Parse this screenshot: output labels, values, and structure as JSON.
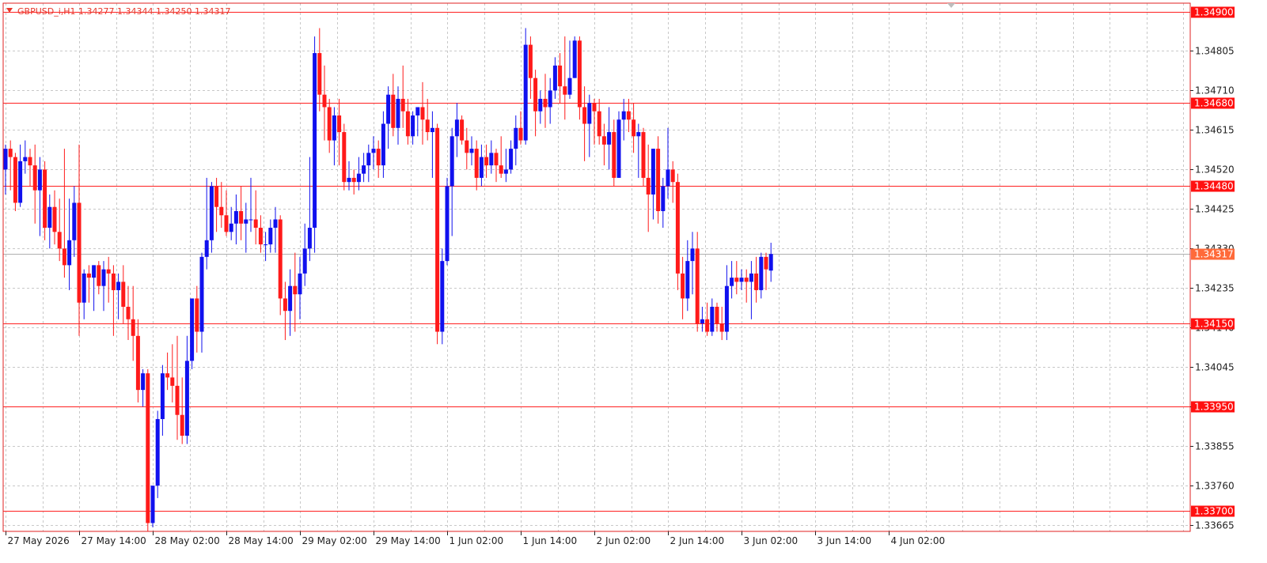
{
  "header": {
    "symbol_line": "GBPUSD_i,H1  1.34277 1.34344 1.34250 1.34317"
  },
  "colors": {
    "bull": "#1010ee",
    "bear": "#ff1a1a",
    "grid": "#c8c8c8",
    "frame": "#e02020",
    "level": "#ff2020",
    "level_label_bg": "#ff1010",
    "current_label_bg": "#ff6a3a",
    "text": "#222222"
  },
  "chart_data": {
    "type": "candlestick",
    "symbol": "GBPUSD_i",
    "timeframe": "H1",
    "last_bar": {
      "open": 1.34277,
      "high": 1.34344,
      "low": 1.3425,
      "close": 1.34317
    },
    "current_price": "1.34317",
    "y_range": [
      1.3365,
      1.3492
    ],
    "y_ticks": [
      "1.34805",
      "1.34710",
      "1.34615",
      "1.34520",
      "1.34425",
      "1.34330",
      "1.34235",
      "1.34140",
      "1.34045",
      "1.33950",
      "1.33855",
      "1.33760",
      "1.33665"
    ],
    "levels": [
      "1.34900",
      "1.34680",
      "1.34480",
      "1.34150",
      "1.33950",
      "1.33700"
    ],
    "x_labels": [
      "27 May 2026",
      "27 May 14:00",
      "28 May 02:00",
      "28 May 14:00",
      "29 May 02:00",
      "29 May 14:00",
      "1 Jun 02:00",
      "1 Jun 14:00",
      "2 Jun 02:00",
      "2 Jun 14:00",
      "3 Jun 02:00",
      "3 Jun 14:00",
      "4 Jun 02:00"
    ],
    "candles": [
      [
        1.3452,
        1.3458,
        1.3446,
        1.3457
      ],
      [
        1.3457,
        1.3459,
        1.3447,
        1.3455
      ],
      [
        1.3455,
        1.3456,
        1.3442,
        1.3444
      ],
      [
        1.3444,
        1.3458,
        1.3443,
        1.3454
      ],
      [
        1.3454,
        1.3459,
        1.3451,
        1.3455
      ],
      [
        1.3455,
        1.3457,
        1.3448,
        1.3453
      ],
      [
        1.3453,
        1.3458,
        1.3439,
        1.3447
      ],
      [
        1.3447,
        1.3455,
        1.3436,
        1.3452
      ],
      [
        1.3452,
        1.3454,
        1.3435,
        1.3438
      ],
      [
        1.3438,
        1.3446,
        1.3433,
        1.3443
      ],
      [
        1.3443,
        1.3447,
        1.3434,
        1.3437
      ],
      [
        1.3437,
        1.3445,
        1.343,
        1.3433
      ],
      [
        1.3433,
        1.3457,
        1.3426,
        1.3429
      ],
      [
        1.3429,
        1.3445,
        1.3423,
        1.3435
      ],
      [
        1.3435,
        1.3448,
        1.3431,
        1.3444
      ],
      [
        1.3444,
        1.3458,
        1.3412,
        1.342
      ],
      [
        1.342,
        1.3428,
        1.3416,
        1.3427
      ],
      [
        1.3427,
        1.3429,
        1.342,
        1.3426
      ],
      [
        1.3426,
        1.3429,
        1.3418,
        1.3429
      ],
      [
        1.3429,
        1.343,
        1.3422,
        1.3424
      ],
      [
        1.3424,
        1.343,
        1.3418,
        1.3428
      ],
      [
        1.3428,
        1.3431,
        1.342,
        1.3427
      ],
      [
        1.3427,
        1.3429,
        1.3412,
        1.3423
      ],
      [
        1.3423,
        1.3427,
        1.3416,
        1.3425
      ],
      [
        1.3425,
        1.3429,
        1.3415,
        1.3419
      ],
      [
        1.3419,
        1.3424,
        1.3411,
        1.3416
      ],
      [
        1.3416,
        1.3424,
        1.3406,
        1.3412
      ],
      [
        1.3412,
        1.3416,
        1.3396,
        1.3399
      ],
      [
        1.3399,
        1.3404,
        1.3395,
        1.3403
      ],
      [
        1.3403,
        1.3404,
        1.3365,
        1.3367
      ],
      [
        1.3367,
        1.3375,
        1.3366,
        1.3376
      ],
      [
        1.3376,
        1.3394,
        1.3373,
        1.3392
      ],
      [
        1.3392,
        1.3405,
        1.3388,
        1.3403
      ],
      [
        1.3403,
        1.3408,
        1.3399,
        1.3402
      ],
      [
        1.3402,
        1.341,
        1.3396,
        1.34
      ],
      [
        1.34,
        1.3412,
        1.3387,
        1.3393
      ],
      [
        1.3393,
        1.3402,
        1.3386,
        1.3388
      ],
      [
        1.3388,
        1.3412,
        1.3386,
        1.3406
      ],
      [
        1.3406,
        1.342,
        1.3404,
        1.3421
      ],
      [
        1.3421,
        1.3424,
        1.3408,
        1.3413
      ],
      [
        1.3413,
        1.3432,
        1.3408,
        1.3431
      ],
      [
        1.3431,
        1.345,
        1.3428,
        1.3435
      ],
      [
        1.3435,
        1.3449,
        1.3432,
        1.3448
      ],
      [
        1.3448,
        1.345,
        1.3437,
        1.3443
      ],
      [
        1.3443,
        1.3449,
        1.3438,
        1.3441
      ],
      [
        1.3441,
        1.3447,
        1.3436,
        1.3437
      ],
      [
        1.3437,
        1.3443,
        1.3435,
        1.3439
      ],
      [
        1.3439,
        1.3446,
        1.3434,
        1.3442
      ],
      [
        1.3442,
        1.3448,
        1.3435,
        1.3439
      ],
      [
        1.3439,
        1.3444,
        1.3432,
        1.344
      ],
      [
        1.344,
        1.345,
        1.3437,
        1.344
      ],
      [
        1.344,
        1.3447,
        1.3434,
        1.3438
      ],
      [
        1.3438,
        1.3441,
        1.3432,
        1.3434
      ],
      [
        1.3434,
        1.3437,
        1.343,
        1.3434
      ],
      [
        1.3434,
        1.344,
        1.3432,
        1.3438
      ],
      [
        1.3438,
        1.3443,
        1.3432,
        1.344
      ],
      [
        1.344,
        1.3441,
        1.3417,
        1.3421
      ],
      [
        1.3421,
        1.3425,
        1.3411,
        1.3418
      ],
      [
        1.3418,
        1.3428,
        1.3412,
        1.3424
      ],
      [
        1.3424,
        1.3432,
        1.3413,
        1.3422
      ],
      [
        1.3422,
        1.3431,
        1.3416,
        1.3427
      ],
      [
        1.3427,
        1.3439,
        1.3424,
        1.3433
      ],
      [
        1.3433,
        1.3455,
        1.343,
        1.3438
      ],
      [
        1.3438,
        1.3484,
        1.3432,
        1.348
      ],
      [
        1.348,
        1.3486,
        1.3466,
        1.347
      ],
      [
        1.347,
        1.3477,
        1.3459,
        1.3467
      ],
      [
        1.3467,
        1.3469,
        1.3456,
        1.3459
      ],
      [
        1.3459,
        1.3467,
        1.3453,
        1.3465
      ],
      [
        1.3465,
        1.3469,
        1.3453,
        1.3461
      ],
      [
        1.3461,
        1.3463,
        1.3447,
        1.3449
      ],
      [
        1.3449,
        1.3454,
        1.3447,
        1.345
      ],
      [
        1.345,
        1.3452,
        1.3446,
        1.3449
      ],
      [
        1.3449,
        1.3455,
        1.3447,
        1.3451
      ],
      [
        1.3451,
        1.3456,
        1.3449,
        1.3453
      ],
      [
        1.3453,
        1.3458,
        1.3449,
        1.3456
      ],
      [
        1.3456,
        1.346,
        1.3452,
        1.3457
      ],
      [
        1.3457,
        1.3459,
        1.345,
        1.3453
      ],
      [
        1.3453,
        1.3466,
        1.345,
        1.3463
      ],
      [
        1.3463,
        1.3472,
        1.3457,
        1.347
      ],
      [
        1.347,
        1.3475,
        1.346,
        1.3462
      ],
      [
        1.3462,
        1.3472,
        1.3458,
        1.3469
      ],
      [
        1.3469,
        1.3477,
        1.3462,
        1.3466
      ],
      [
        1.3466,
        1.3469,
        1.3458,
        1.346
      ],
      [
        1.346,
        1.3466,
        1.3458,
        1.3465
      ],
      [
        1.3465,
        1.3467,
        1.346,
        1.3467
      ],
      [
        1.3467,
        1.3473,
        1.3458,
        1.3464
      ],
      [
        1.3464,
        1.3469,
        1.3459,
        1.3461
      ],
      [
        1.3461,
        1.3466,
        1.345,
        1.3462
      ],
      [
        1.3462,
        1.3463,
        1.341,
        1.3413
      ],
      [
        1.3413,
        1.3433,
        1.341,
        1.343
      ],
      [
        1.343,
        1.345,
        1.3429,
        1.3448
      ],
      [
        1.3448,
        1.3462,
        1.3436,
        1.346
      ],
      [
        1.346,
        1.3468,
        1.3455,
        1.3464
      ],
      [
        1.3464,
        1.3465,
        1.3458,
        1.3459
      ],
      [
        1.3459,
        1.3462,
        1.3452,
        1.3456
      ],
      [
        1.3456,
        1.346,
        1.3453,
        1.3457
      ],
      [
        1.3457,
        1.3459,
        1.3447,
        1.345
      ],
      [
        1.345,
        1.3458,
        1.3448,
        1.3455
      ],
      [
        1.3455,
        1.3458,
        1.345,
        1.3453
      ],
      [
        1.3453,
        1.3459,
        1.3451,
        1.3456
      ],
      [
        1.3456,
        1.3457,
        1.3449,
        1.3453
      ],
      [
        1.3453,
        1.346,
        1.345,
        1.3451
      ],
      [
        1.3451,
        1.3457,
        1.3449,
        1.3452
      ],
      [
        1.3452,
        1.3459,
        1.3451,
        1.3457
      ],
      [
        1.3457,
        1.3465,
        1.3453,
        1.3462
      ],
      [
        1.3462,
        1.3466,
        1.3458,
        1.3459
      ],
      [
        1.3459,
        1.3486,
        1.3458,
        1.3482
      ],
      [
        1.3482,
        1.3484,
        1.3469,
        1.3474
      ],
      [
        1.3474,
        1.3476,
        1.346,
        1.3466
      ],
      [
        1.3466,
        1.3471,
        1.3463,
        1.3469
      ],
      [
        1.3469,
        1.3475,
        1.3462,
        1.3467
      ],
      [
        1.3467,
        1.3474,
        1.3463,
        1.3471
      ],
      [
        1.3471,
        1.3479,
        1.3469,
        1.3477
      ],
      [
        1.3477,
        1.348,
        1.3468,
        1.3472
      ],
      [
        1.3472,
        1.3484,
        1.3464,
        1.347
      ],
      [
        1.347,
        1.3483,
        1.3469,
        1.3474
      ],
      [
        1.3474,
        1.3484,
        1.3474,
        1.3483
      ],
      [
        1.3483,
        1.3484,
        1.3464,
        1.3467
      ],
      [
        1.3467,
        1.3472,
        1.3454,
        1.3463
      ],
      [
        1.3463,
        1.347,
        1.3455,
        1.3468
      ],
      [
        1.3468,
        1.3469,
        1.3458,
        1.3466
      ],
      [
        1.3466,
        1.3469,
        1.3458,
        1.346
      ],
      [
        1.346,
        1.3463,
        1.3453,
        1.3458
      ],
      [
        1.3458,
        1.3467,
        1.3452,
        1.3461
      ],
      [
        1.3461,
        1.3464,
        1.3448,
        1.345
      ],
      [
        1.345,
        1.3466,
        1.345,
        1.3464
      ],
      [
        1.3464,
        1.3469,
        1.3459,
        1.3466
      ],
      [
        1.3466,
        1.3469,
        1.3461,
        1.3464
      ],
      [
        1.3464,
        1.3468,
        1.3456,
        1.346
      ],
      [
        1.346,
        1.3463,
        1.345,
        1.3461
      ],
      [
        1.3461,
        1.3462,
        1.3448,
        1.345
      ],
      [
        1.345,
        1.3458,
        1.3437,
        1.3446
      ],
      [
        1.3446,
        1.3457,
        1.344,
        1.3457
      ],
      [
        1.3457,
        1.346,
        1.3439,
        1.3442
      ],
      [
        1.3442,
        1.345,
        1.3438,
        1.3448
      ],
      [
        1.3448,
        1.3462,
        1.3445,
        1.3452
      ],
      [
        1.3452,
        1.3454,
        1.3444,
        1.3449
      ],
      [
        1.3449,
        1.3451,
        1.3423,
        1.3427
      ],
      [
        1.3427,
        1.3431,
        1.3416,
        1.3421
      ],
      [
        1.3421,
        1.3435,
        1.3418,
        1.343
      ],
      [
        1.343,
        1.3437,
        1.3422,
        1.3433
      ],
      [
        1.3433,
        1.3437,
        1.3413,
        1.3415
      ],
      [
        1.3415,
        1.3419,
        1.3413,
        1.3416
      ],
      [
        1.3416,
        1.342,
        1.3412,
        1.3413
      ],
      [
        1.3413,
        1.3421,
        1.3412,
        1.3419
      ],
      [
        1.3419,
        1.342,
        1.3413,
        1.3415
      ],
      [
        1.3415,
        1.3419,
        1.3411,
        1.3413
      ],
      [
        1.3413,
        1.3429,
        1.3411,
        1.3424
      ],
      [
        1.3424,
        1.343,
        1.3421,
        1.3426
      ],
      [
        1.3426,
        1.343,
        1.3422,
        1.3425
      ],
      [
        1.3425,
        1.3428,
        1.3423,
        1.3426
      ],
      [
        1.3426,
        1.3428,
        1.342,
        1.3425
      ],
      [
        1.3425,
        1.343,
        1.3416,
        1.3427
      ],
      [
        1.3427,
        1.3431,
        1.342,
        1.3423
      ],
      [
        1.3423,
        1.3432,
        1.3421,
        1.3431
      ],
      [
        1.3431,
        1.3432,
        1.3423,
        1.3428
      ],
      [
        1.34277,
        1.34344,
        1.3425,
        1.34317
      ]
    ]
  }
}
